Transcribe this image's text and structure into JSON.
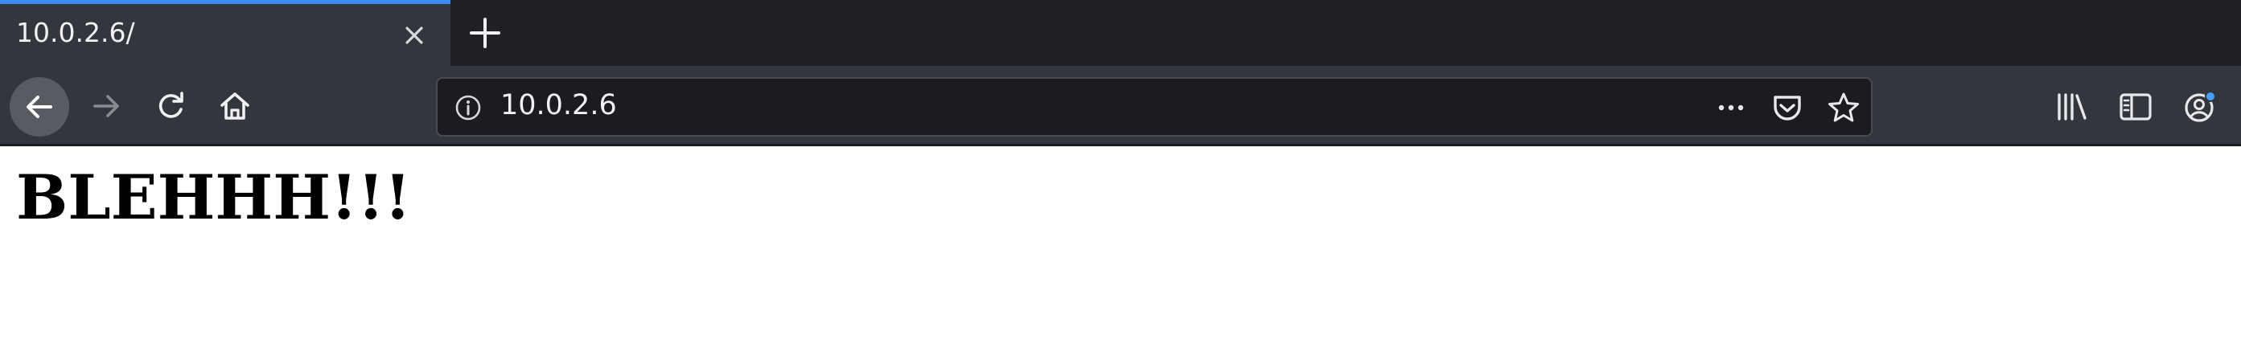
{
  "browser": {
    "tab": {
      "title": "10.0.2.6/",
      "close_icon": "close-icon",
      "active_indicator_color": "#3b8cf2"
    },
    "new_tab_icon": "plus-icon",
    "nav": {
      "back_icon": "arrow-left-icon",
      "forward_icon": "arrow-right-icon",
      "reload_icon": "reload-icon",
      "home_icon": "home-icon"
    },
    "urlbar": {
      "info_icon": "info-icon",
      "url": "10.0.2.6",
      "more_icon": "ellipsis-icon",
      "pocket_icon": "pocket-icon",
      "bookmark_icon": "star-icon"
    },
    "toolbar": {
      "library_icon": "library-icon",
      "sidebar_icon": "sidebar-icon",
      "account_icon": "account-icon"
    },
    "theme": {
      "tabstrip_bg": "#1f2127",
      "toolbar_bg": "#34363d",
      "urlbar_bg": "#1c1b22",
      "text_color": "#f1f1f4"
    }
  },
  "page": {
    "heading": "BLEHHH!!!"
  }
}
